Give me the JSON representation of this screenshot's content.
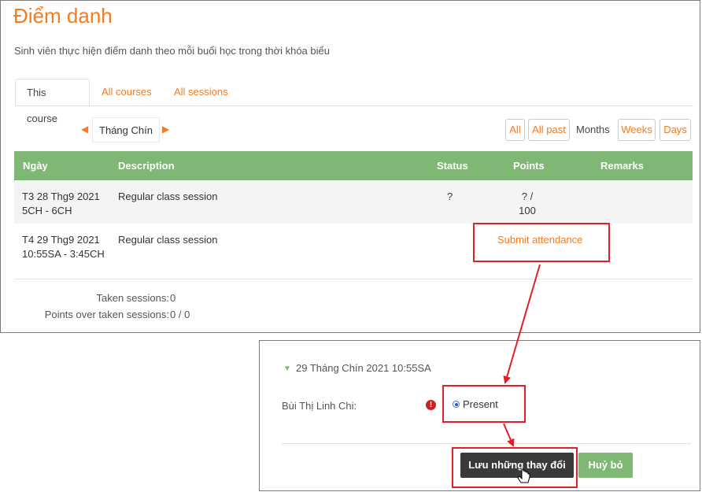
{
  "page": {
    "title": "Điểm danh",
    "subtitle": "Sinh viên thực hiện điểm danh theo mỗi buổi học trong thời khóa biểu"
  },
  "tabs": [
    {
      "label": "This course",
      "active": true
    },
    {
      "label": "All courses",
      "active": false
    },
    {
      "label": "All sessions",
      "active": false
    }
  ],
  "month_nav": {
    "prev_icon": "◀",
    "current": "Tháng Chín",
    "next_icon": "▶"
  },
  "view_buttons": {
    "all": "All",
    "all_past": "All past",
    "months": "Months",
    "weeks": "Weeks",
    "days": "Days"
  },
  "table": {
    "headers": {
      "date": "Ngày",
      "description": "Description",
      "status": "Status",
      "points": "Points",
      "remarks": "Remarks"
    },
    "rows": [
      {
        "date_line1": "T3 28 Thg9 2021",
        "date_line2": "5CH - 6CH",
        "description": "Regular class session",
        "status": "?",
        "points_line1": "? /",
        "points_line2": "100"
      },
      {
        "date_line1": "T4 29 Thg9 2021",
        "date_line2": "10:55SA - 3:45CH",
        "description": "Regular class session",
        "action": "Submit attendance"
      }
    ]
  },
  "summary": {
    "taken_label": "Taken sessions:",
    "taken_value": "0",
    "points_label": "Points over taken sessions:",
    "points_value": "0 / 0"
  },
  "form": {
    "session_title": "29 Tháng Chín 2021 10:55SA",
    "student_name": "Bùi Thị Linh Chi:",
    "warning_icon": "!",
    "option_label": "Present",
    "save_label": "Lưu những thay đổi",
    "cancel_label": "Huỷ bỏ"
  },
  "colors": {
    "accent": "#f47b20",
    "table_header": "#7fb774",
    "callout": "#e41e26",
    "dark_button": "#3a3a3a"
  }
}
